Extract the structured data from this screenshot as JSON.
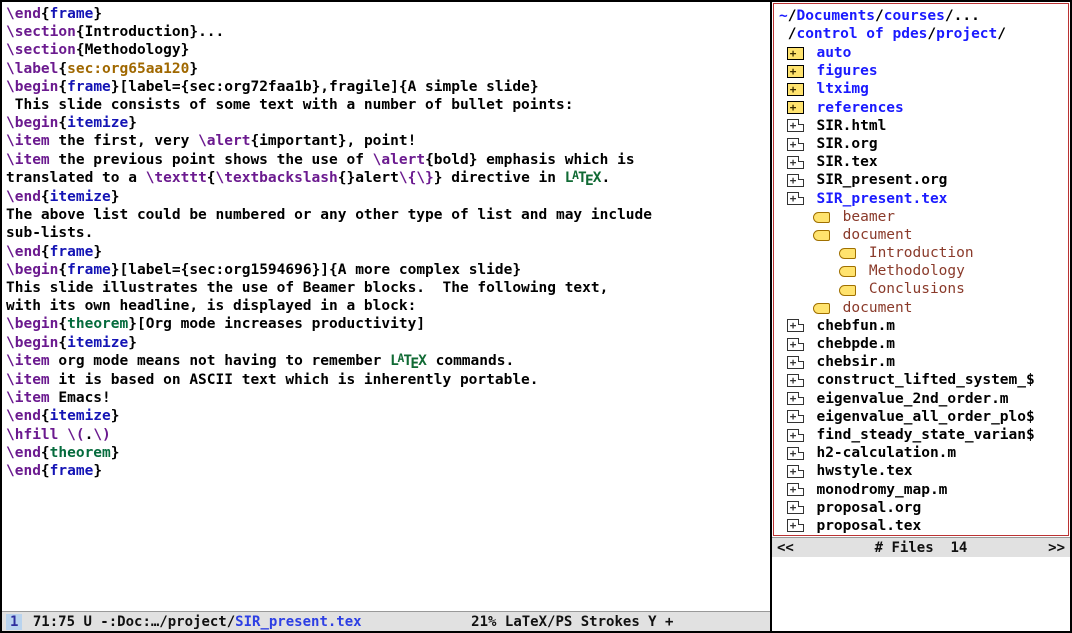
{
  "editor": {
    "lines": [
      {
        "t": [
          [
            "kw",
            "\\end"
          ],
          [
            "punct",
            "{"
          ],
          [
            "fn",
            "frame"
          ],
          [
            "punct",
            "}"
          ]
        ]
      },
      {
        "t": [
          [
            "txt",
            ""
          ]
        ]
      },
      {
        "t": [
          [
            "txt",
            ""
          ]
        ]
      },
      {
        "t": [
          [
            "kw",
            "\\section"
          ],
          [
            "punct",
            "{"
          ],
          [
            "secname",
            "Introduction"
          ],
          [
            "punct",
            "}"
          ],
          [
            "txt",
            "..."
          ]
        ]
      },
      {
        "t": [
          [
            "kw",
            "\\section"
          ],
          [
            "punct",
            "{"
          ],
          [
            "secname",
            "Methodology"
          ],
          [
            "punct",
            "}"
          ]
        ]
      },
      {
        "t": [
          [
            "kw",
            "\\label"
          ],
          [
            "punct",
            "{"
          ],
          [
            "var",
            "sec:org65aa120"
          ],
          [
            "punct",
            "}"
          ]
        ]
      },
      {
        "t": [
          [
            "txt",
            ""
          ]
        ]
      },
      {
        "t": [
          [
            "kw",
            "\\begin"
          ],
          [
            "punct",
            "{"
          ],
          [
            "fn",
            "frame"
          ],
          [
            "punct",
            "}"
          ],
          [
            "txt",
            "[label={sec:org72faa1b},fragile]{A simple slide}"
          ]
        ]
      },
      {
        "t": [
          [
            "txt",
            " This slide consists of some text with a number of bullet points:"
          ]
        ]
      },
      {
        "t": [
          [
            "txt",
            ""
          ]
        ]
      },
      {
        "t": [
          [
            "kw",
            "\\begin"
          ],
          [
            "punct",
            "{"
          ],
          [
            "fn",
            "itemize"
          ],
          [
            "punct",
            "}"
          ]
        ]
      },
      {
        "t": [
          [
            "kw",
            "\\item"
          ],
          [
            "txt",
            " the first, very "
          ],
          [
            "kw",
            "\\alert"
          ],
          [
            "txt",
            "{important}, point!"
          ]
        ]
      },
      {
        "t": [
          [
            "kw",
            "\\item"
          ],
          [
            "txt",
            " the previous point shows the use of "
          ],
          [
            "kw",
            "\\alert"
          ],
          [
            "txt",
            "{bold} emphasis which is"
          ]
        ]
      },
      {
        "t": [
          [
            "txt",
            "translated to a "
          ],
          [
            "kw",
            "\\texttt"
          ],
          [
            "punct",
            "{"
          ],
          [
            "kw",
            "\\textbackslash"
          ],
          [
            "txt",
            "{}alert"
          ],
          [
            "kw",
            "\\{\\}"
          ],
          [
            "punct",
            "}"
          ],
          [
            "txt",
            " directive in "
          ],
          [
            "latex",
            "LaTeX"
          ],
          [
            "txt",
            "."
          ]
        ]
      },
      {
        "t": [
          [
            "kw",
            "\\end"
          ],
          [
            "punct",
            "{"
          ],
          [
            "fn",
            "itemize"
          ],
          [
            "punct",
            "}"
          ]
        ]
      },
      {
        "t": [
          [
            "txt",
            ""
          ]
        ]
      },
      {
        "t": [
          [
            "txt",
            "The above list could be numbered or any other type of list and may include"
          ]
        ]
      },
      {
        "t": [
          [
            "txt",
            "sub-lists."
          ]
        ]
      },
      {
        "t": [
          [
            "kw",
            "\\end"
          ],
          [
            "punct",
            "{"
          ],
          [
            "fn",
            "frame"
          ],
          [
            "punct",
            "}"
          ]
        ]
      },
      {
        "t": [
          [
            "txt",
            ""
          ]
        ]
      },
      {
        "t": [
          [
            "kw",
            "\\begin"
          ],
          [
            "punct",
            "{"
          ],
          [
            "fn",
            "frame"
          ],
          [
            "punct",
            "}"
          ],
          [
            "txt",
            "[label={sec:org1594696}]{A more complex slide}"
          ]
        ]
      },
      {
        "t": [
          [
            "txt",
            "This slide illustrates the use of Beamer blocks.  The following text,"
          ]
        ]
      },
      {
        "t": [
          [
            "txt",
            "with its own headline, is displayed in a block:"
          ]
        ]
      },
      {
        "t": [
          [
            "kw",
            "\\begin"
          ],
          [
            "punct",
            "{"
          ],
          [
            "env",
            "theorem"
          ],
          [
            "punct",
            "}"
          ],
          [
            "txt",
            "[Org mode increases productivity]"
          ]
        ]
      },
      {
        "t": [
          [
            "kw",
            "\\begin"
          ],
          [
            "punct",
            "{"
          ],
          [
            "fn",
            "itemize"
          ],
          [
            "punct",
            "}"
          ]
        ]
      },
      {
        "t": [
          [
            "kw",
            "\\item"
          ],
          [
            "txt",
            " org mode means not having to remember "
          ],
          [
            "latex",
            "LaTeX"
          ],
          [
            "txt",
            " commands."
          ]
        ]
      },
      {
        "t": [
          [
            "kw",
            "\\item"
          ],
          [
            "txt",
            " it is based on ASCII text which is inherently portable."
          ]
        ]
      },
      {
        "t": [
          [
            "kw",
            "\\item"
          ],
          [
            "txt",
            " Emacs!"
          ]
        ]
      },
      {
        "t": [
          [
            "kw",
            "\\end"
          ],
          [
            "punct",
            "{"
          ],
          [
            "fn",
            "itemize"
          ],
          [
            "punct",
            "}"
          ]
        ]
      },
      {
        "t": [
          [
            "txt",
            ""
          ]
        ]
      },
      {
        "t": [
          [
            "kw",
            "\\hfill"
          ],
          [
            "txt",
            " "
          ],
          [
            "kw",
            "\\("
          ],
          [
            "txt",
            "."
          ],
          [
            "kw",
            "\\)"
          ]
        ]
      },
      {
        "t": [
          [
            "kw",
            "\\end"
          ],
          [
            "punct",
            "{"
          ],
          [
            "env",
            "theorem"
          ],
          [
            "punct",
            "}"
          ]
        ]
      },
      {
        "t": [
          [
            "kw",
            "\\end"
          ],
          [
            "punct",
            "{"
          ],
          [
            "fn",
            "frame"
          ],
          [
            "punct",
            "}"
          ]
        ]
      }
    ]
  },
  "modeline_left": {
    "num": "1",
    "pos": " 71:75 U -:Doc:…/project/",
    "fname": "SIR_present.tex",
    "spacer": "             ",
    "pct": "21% ",
    "mode": "LaTeX/PS",
    "tail": " Strokes Y +"
  },
  "path": {
    "prefix": "~",
    "segs": [
      "Documents",
      "courses",
      "..."
    ],
    "segs2": [
      "control of pdes",
      "project"
    ],
    "trail": "/"
  },
  "tree": [
    {
      "kind": "folder",
      "label": "auto",
      "cls": "dir-label",
      "indent": 0
    },
    {
      "kind": "folder",
      "label": "figures",
      "cls": "dir-label",
      "indent": 0
    },
    {
      "kind": "folder",
      "label": "ltximg",
      "cls": "dir-label",
      "indent": 0
    },
    {
      "kind": "folder",
      "label": "references",
      "cls": "dir-label",
      "indent": 0
    },
    {
      "kind": "file",
      "label": "SIR.html",
      "cls": "file-label",
      "indent": 0
    },
    {
      "kind": "file",
      "label": "SIR.org",
      "cls": "file-label",
      "indent": 0
    },
    {
      "kind": "file",
      "label": "SIR.tex",
      "cls": "file-label",
      "indent": 0
    },
    {
      "kind": "file",
      "label": "SIR_present.org",
      "cls": "file-label",
      "indent": 0
    },
    {
      "kind": "file",
      "label": "SIR_present.tex",
      "cls": "active-label",
      "indent": 0,
      "open": true
    },
    {
      "kind": "tag",
      "label": "beamer",
      "cls": "outline-label",
      "indent": 1
    },
    {
      "kind": "tag",
      "label": "document",
      "cls": "outline-label",
      "indent": 1
    },
    {
      "kind": "tag",
      "label": "Introduction",
      "cls": "outline-label",
      "indent": 2
    },
    {
      "kind": "tag",
      "label": "Methodology",
      "cls": "outline-label",
      "indent": 2
    },
    {
      "kind": "tag",
      "label": "Conclusions",
      "cls": "outline-label",
      "indent": 2
    },
    {
      "kind": "tag",
      "label": "document",
      "cls": "outline-label",
      "indent": 1
    },
    {
      "kind": "file",
      "label": "chebfun.m",
      "cls": "file-label",
      "indent": 0
    },
    {
      "kind": "file",
      "label": "chebpde.m",
      "cls": "file-label",
      "indent": 0
    },
    {
      "kind": "file",
      "label": "chebsir.m",
      "cls": "file-label",
      "indent": 0
    },
    {
      "kind": "file",
      "label": "construct_lifted_system_",
      "cls": "file-label",
      "indent": 0,
      "trunc": "$"
    },
    {
      "kind": "file",
      "label": "eigenvalue_2nd_order.m",
      "cls": "file-label",
      "indent": 0
    },
    {
      "kind": "file",
      "label": "eigenvalue_all_order_plo",
      "cls": "file-label",
      "indent": 0,
      "trunc": "$"
    },
    {
      "kind": "file",
      "label": "find_steady_state_varian",
      "cls": "file-label",
      "indent": 0,
      "trunc": "$"
    },
    {
      "kind": "file",
      "label": "h2-calculation.m",
      "cls": "file-label",
      "indent": 0
    },
    {
      "kind": "file",
      "label": "hwstyle.tex",
      "cls": "file-label",
      "indent": 0
    },
    {
      "kind": "file",
      "label": "monodromy_map.m",
      "cls": "file-label",
      "indent": 0
    },
    {
      "kind": "file",
      "label": "proposal.org",
      "cls": "file-label",
      "indent": 0
    },
    {
      "kind": "file",
      "label": "proposal.tex",
      "cls": "file-label",
      "indent": 0
    }
  ],
  "modeline_right": {
    "left": "<<",
    "mid": "# Files  14",
    "right": ">>"
  }
}
